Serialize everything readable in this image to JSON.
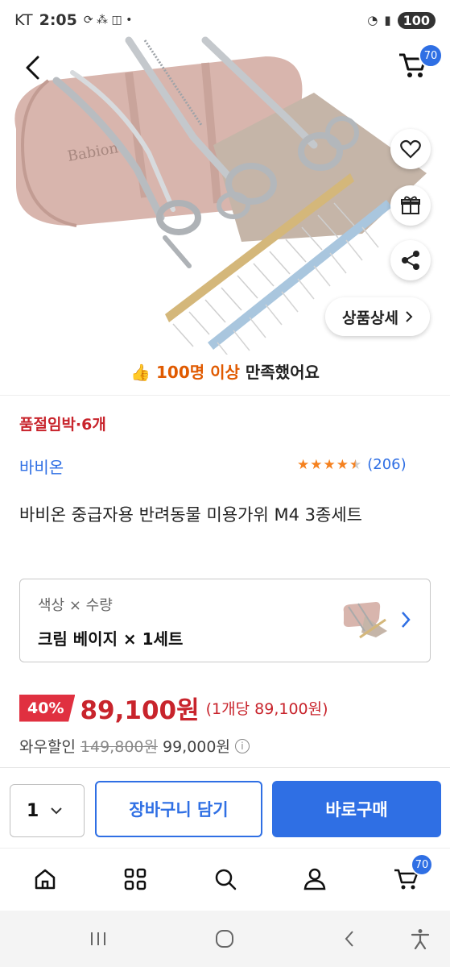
{
  "status_bar": {
    "carrier": "KT",
    "time": "2:05",
    "battery": "100"
  },
  "header": {
    "cart_count": "70"
  },
  "hero": {
    "detail_button_label": "상품상세"
  },
  "satisfaction": {
    "highlight": "100명 이상",
    "text": " 만족했어요"
  },
  "product": {
    "stock_notice": "품절임박·6개",
    "brand": "바비온",
    "review_count": "(206)",
    "rating": 4.5,
    "title": "바비온 중급자용 반려동물 미용가위 M4 3종세트"
  },
  "option": {
    "label": "색상 × 수량",
    "value": "크림 베이지 × 1세트"
  },
  "price": {
    "discount": "40%",
    "sale_price": "89,100원",
    "unit_price": "(1개당 89,100원)",
    "wow_label": "와우할인",
    "original_price": "149,800원",
    "wow_price": "99,000원",
    "info_glyph": "i"
  },
  "actions": {
    "quantity": "1",
    "cart_button": "장바구니 담기",
    "buy_button": "바로구매"
  },
  "tabbar": {
    "cart_count": "70"
  },
  "colors": {
    "accent": "#2f6fe4",
    "sale_red": "#c8242c",
    "badge_red": "#e03040",
    "star": "#f5811f"
  }
}
